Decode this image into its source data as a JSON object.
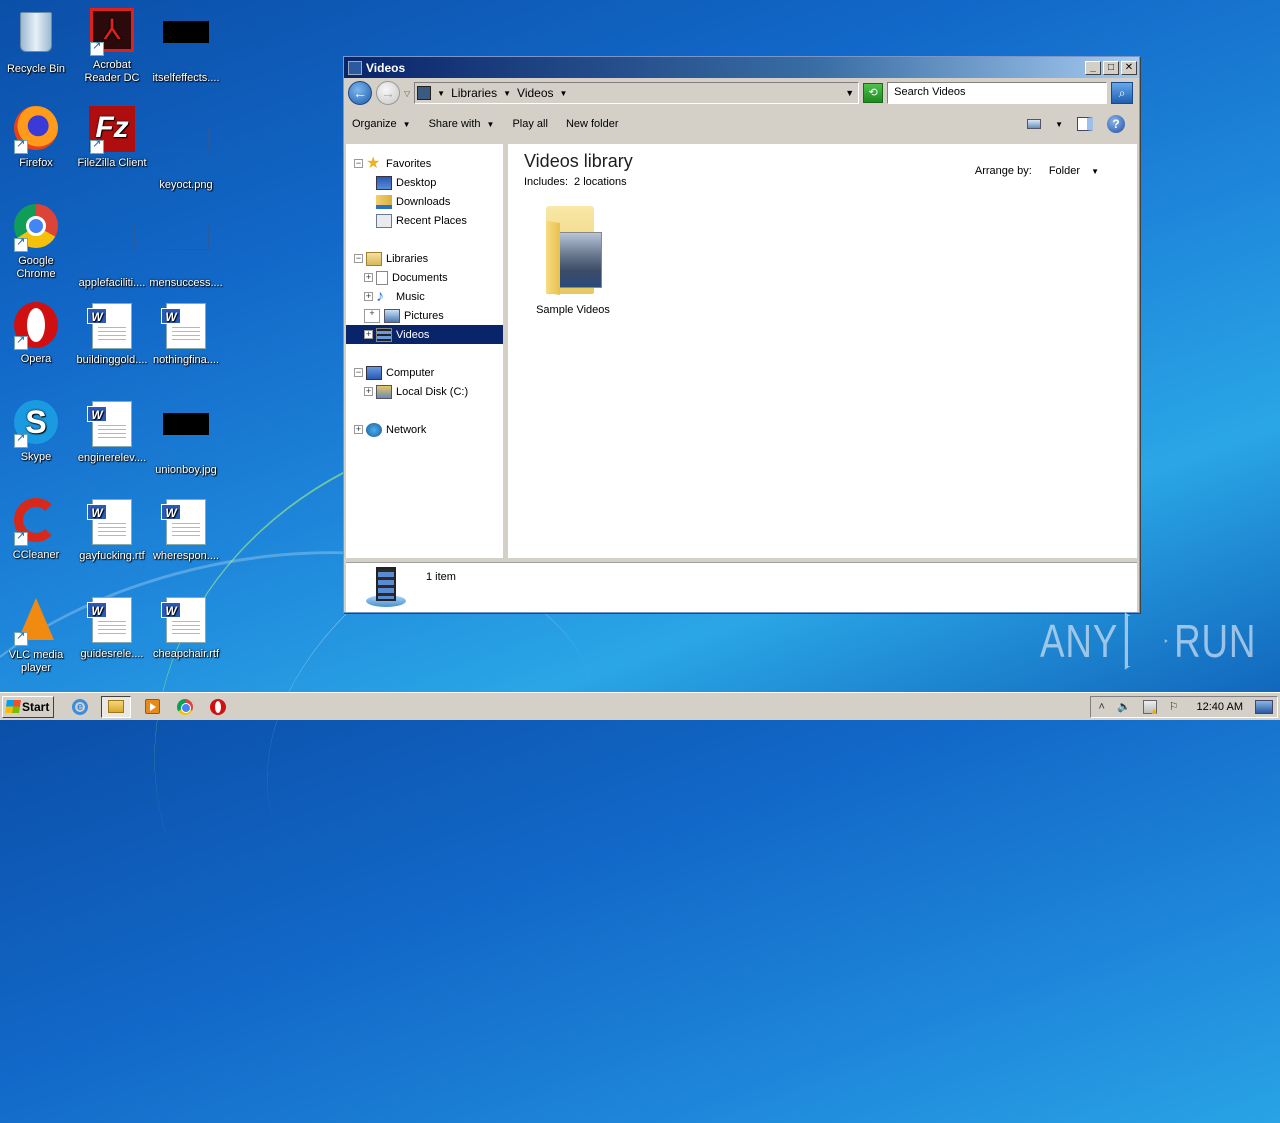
{
  "desktop": {
    "icons": [
      {
        "label": "Recycle Bin",
        "icon": "recycle-bin-icon"
      },
      {
        "label": "Acrobat Reader DC",
        "icon": "acrobat-icon"
      },
      {
        "label": "itselfeffects....",
        "icon": "image-file-icon"
      },
      {
        "label": "Firefox",
        "icon": "firefox-icon"
      },
      {
        "label": "FileZilla Client",
        "icon": "filezilla-icon"
      },
      {
        "label": "keyoct.png",
        "icon": "image-file-icon"
      },
      {
        "label": "Google Chrome",
        "icon": "chrome-icon"
      },
      {
        "label": "applefaciliti....",
        "icon": "file-icon"
      },
      {
        "label": "mensuccess....",
        "icon": "file-icon"
      },
      {
        "label": "Opera",
        "icon": "opera-icon"
      },
      {
        "label": "buildinggold....",
        "icon": "word-doc-icon"
      },
      {
        "label": "nothingfina....",
        "icon": "word-doc-icon"
      },
      {
        "label": "Skype",
        "icon": "skype-icon"
      },
      {
        "label": "enginerelev....",
        "icon": "word-doc-icon"
      },
      {
        "label": "unionboy.jpg",
        "icon": "image-file-icon"
      },
      {
        "label": "CCleaner",
        "icon": "ccleaner-icon"
      },
      {
        "label": "gayfucking.rtf",
        "icon": "word-doc-icon"
      },
      {
        "label": "wherespon....",
        "icon": "word-doc-icon"
      },
      {
        "label": "VLC media player",
        "icon": "vlc-icon"
      },
      {
        "label": "guidesrele....",
        "icon": "word-doc-icon"
      },
      {
        "label": "cheapchair.rtf",
        "icon": "word-doc-icon"
      }
    ]
  },
  "window": {
    "title": "Videos",
    "address": {
      "crumbs": [
        "Libraries",
        "Videos"
      ]
    },
    "search_placeholder": "Search Videos",
    "toolbar": {
      "organize": "Organize",
      "share_with": "Share with",
      "play_all": "Play all",
      "new_folder": "New folder"
    },
    "nav": {
      "favorites": "Favorites",
      "desktop": "Desktop",
      "downloads": "Downloads",
      "recent_places": "Recent Places",
      "libraries": "Libraries",
      "documents": "Documents",
      "music": "Music",
      "pictures": "Pictures",
      "videos": "Videos",
      "computer": "Computer",
      "local_disk": "Local Disk (C:)",
      "network": "Network"
    },
    "content": {
      "title": "Videos library",
      "includes_label": "Includes:",
      "includes_value": "2 locations",
      "arrange_label": "Arrange by:",
      "arrange_value": "Folder",
      "items": [
        {
          "name": "Sample Videos"
        }
      ]
    },
    "status": {
      "count": "1 item"
    }
  },
  "watermark": {
    "left": "ANY",
    "right": "RUN"
  },
  "taskbar": {
    "start": "Start",
    "clock": "12:40 AM"
  }
}
